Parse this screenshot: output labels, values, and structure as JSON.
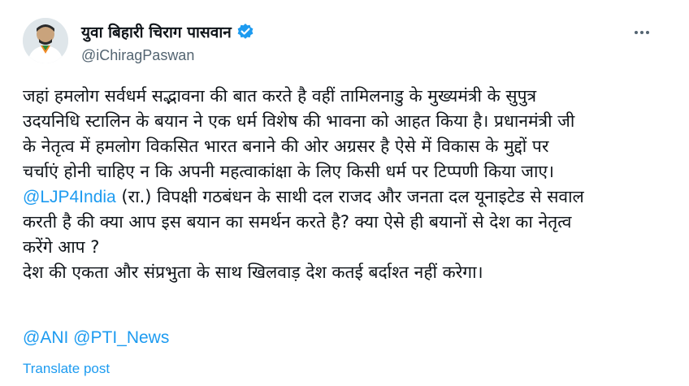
{
  "author": {
    "display_name": "युवा बिहारी चिराग पासवान",
    "handle": "@iChiragPaswan",
    "verified_color": "#1d9bf0"
  },
  "tweet": {
    "lines": [
      "जहां हमलोग सर्वधर्म सद्भावना की बात करते है वहीं तामिलनाडु के मुख्यमंत्री के सुपुत्र",
      "उदयनिधि स्टालिन के बयान ने एक धर्म विशेष की भावना को आहत किया है। प्रधानमंत्री जी",
      "के नेतृत्व में हमलोग विकसित भारत बनाने की ओर अग्रसर है ऐसे में विकास के मुद्दों पर",
      "चर्चाएं होनी चाहिए न कि अपनी महत्वाकांक्षा के लिए किसी धर्म पर टिप्पणी किया जाए।"
    ],
    "mention_ljp": "@LJP4India",
    "line_after_mention": " (रा.) विपक्षी गठबंधन के साथी दल राजद और जनता दल यूनाइटेड से सवाल",
    "lines_2": [
      "करती है की क्या आप इस बयान का समर्थन करते है? क्या ऐसे ही बयानों से देश का नेतृत्व",
      "करेंगे आप ?",
      "देश की एकता और संप्रभुता के साथ खिलवाड़ देश कतई बर्दाश्त नहीं करेगा।"
    ],
    "mention_ani": "@ANI",
    "mention_pti": "@PTI_News",
    "translate_label": "Translate post"
  },
  "icons": {
    "verified": "verified-badge-icon",
    "more": "more-options-icon"
  }
}
